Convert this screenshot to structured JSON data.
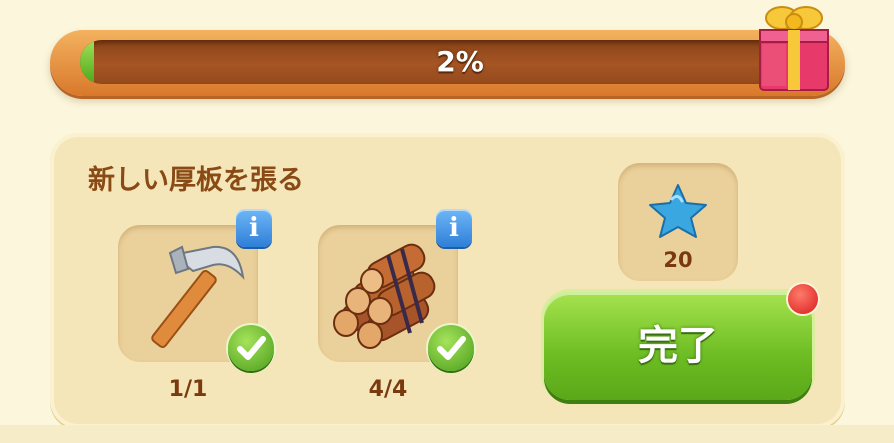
{
  "progress": {
    "label": "2%",
    "fraction": 0.02
  },
  "gift": {
    "icon": "gift-box-icon"
  },
  "task": {
    "title": "新しい厚板を張る",
    "requirements": [
      {
        "icon": "hammer-icon",
        "count": "1/1",
        "completed": true
      },
      {
        "icon": "logs-icon",
        "count": "4/4",
        "completed": true
      }
    ],
    "reward": {
      "icon": "blue-star-icon",
      "amount": "20"
    },
    "complete_button": {
      "label": "完了"
    }
  },
  "colors": {
    "progress_fill": "#6cc22a",
    "button_green": "#6cbc22",
    "info_blue": "#2f7fd8",
    "title_brown": "#8a4a15"
  }
}
